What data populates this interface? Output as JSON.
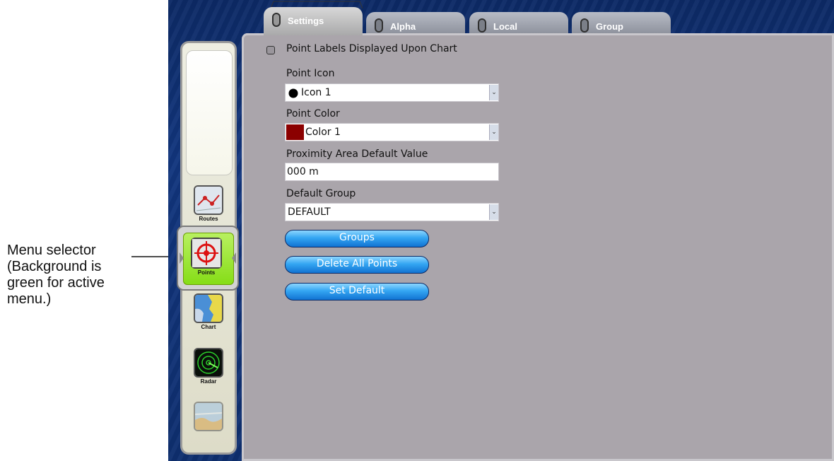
{
  "annotation": {
    "lines": [
      "Menu selector",
      "(Background is",
      "green for active",
      "menu.)"
    ]
  },
  "tabs": [
    {
      "label": "Settings",
      "active": true
    },
    {
      "label": "Alpha",
      "active": false
    },
    {
      "label": "Local",
      "active": false
    },
    {
      "label": "Group",
      "active": false
    }
  ],
  "sidebar": {
    "items": [
      {
        "label": "Routes",
        "icon": "routes-icon"
      },
      {
        "label": "Points",
        "icon": "points-crosshair-icon",
        "active": true
      },
      {
        "label": "Chart",
        "icon": "chart-map-icon"
      },
      {
        "label": "Radar",
        "icon": "radar-icon"
      },
      {
        "label": "",
        "icon": "sounder-icon"
      }
    ]
  },
  "settings": {
    "point_labels_checkbox_label": "Point Labels Displayed Upon Chart",
    "point_icon": {
      "label": "Point Icon",
      "value": "Icon 1"
    },
    "point_color": {
      "label": "Point Color",
      "value": "Color 1",
      "swatch": "#8b0000"
    },
    "proximity": {
      "label": "Proximity Area Default Value",
      "value": "000 m"
    },
    "default_group": {
      "label": "Default Group",
      "value": "DEFAULT"
    },
    "buttons": {
      "groups": "Groups",
      "delete_all": "Delete All Points",
      "set_default": "Set Default"
    }
  },
  "colors": {
    "active_menu_bg": "#86dd18",
    "button_blue": "#34a6f2",
    "panel_bg": "#aaa5ab",
    "background_blue": "#12367e"
  }
}
